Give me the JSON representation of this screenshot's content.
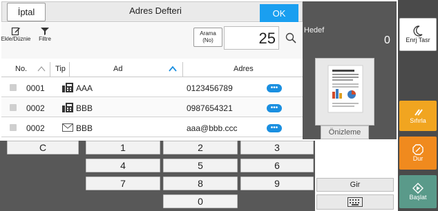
{
  "header": {
    "cancel_label": "İptal",
    "title": "Adres Defteri",
    "ok_label": "OK"
  },
  "toolbar": {
    "edit_label": "Ekle/Düznie",
    "filter_label": "Filtre",
    "search_label_line1": "Arama",
    "search_label_line2": "(No)",
    "search_value": "25"
  },
  "table": {
    "columns": [
      "No.",
      "Tip",
      "Ad",
      "Adres"
    ],
    "rows": [
      {
        "no": "0001",
        "type_icon": "fax-icon",
        "name": "AAA",
        "address": "0123456789"
      },
      {
        "no": "0002",
        "type_icon": "fax-icon",
        "name": "BBB",
        "address": "0987654321"
      },
      {
        "no": "0002",
        "type_icon": "email-icon",
        "name": "BBB",
        "address": "aaa@bbb.ccc"
      }
    ],
    "more_icon": "more-dots-icon"
  },
  "keypad": {
    "clear": "C",
    "keys": [
      "1",
      "2",
      "3",
      "4",
      "5",
      "6",
      "7",
      "8",
      "9",
      "0"
    ]
  },
  "right_panel": {
    "target_label": "Hedef",
    "target_count": "0",
    "preview_label": "Önizleme",
    "enter_label": "Gir",
    "keyboard_icon": "keyboard-icon"
  },
  "side": {
    "energy_label": "Enrj Tasr",
    "reset_label": "Sıfırla",
    "stop_label": "Dur",
    "start_label": "Başlat"
  },
  "colors": {
    "ok_blue": "#1a9ff0",
    "more_blue": "#1a8fe0",
    "reset_orange": "#f1a520",
    "stop_orange": "#f08a1e",
    "start_teal": "#5a9a8a",
    "dark_panel": "#575757"
  }
}
